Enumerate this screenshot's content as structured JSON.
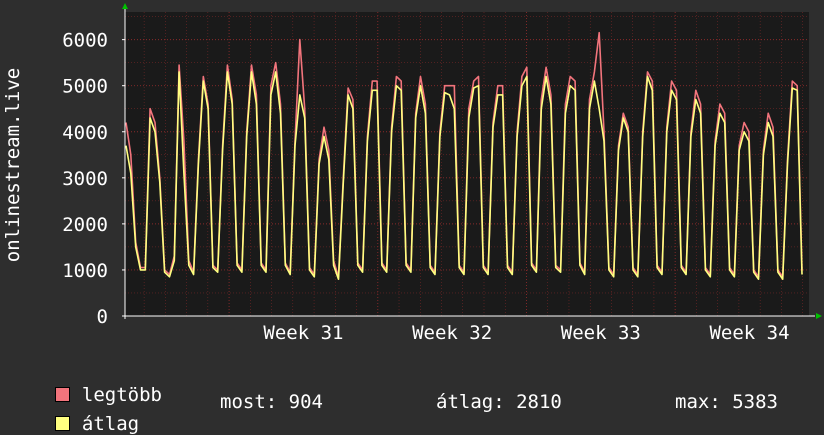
{
  "chart_data": {
    "type": "line",
    "ylabel": "onlinestream.live",
    "ylim": [
      0,
      6600
    ],
    "yticks": [
      0,
      1000,
      2000,
      3000,
      4000,
      5000,
      6000
    ],
    "xrange_weeks": [
      30.3,
      34.9
    ],
    "xticks": [
      {
        "label": "Week 31",
        "at": 31
      },
      {
        "label": "Week 32",
        "at": 32
      },
      {
        "label": "Week 33",
        "at": 33
      },
      {
        "label": "Week 34",
        "at": 34
      }
    ],
    "grid": true,
    "legend_placement": "bottom",
    "series": [
      {
        "name": "legtöbb",
        "color": "#f2747c",
        "values": [
          4200,
          3500,
          1600,
          1050,
          1050,
          4500,
          4200,
          3000,
          1000,
          900,
          1300,
          5450,
          3800,
          1200,
          950,
          3400,
          5200,
          4600,
          1100,
          1000,
          3700,
          5450,
          4700,
          1150,
          1000,
          4000,
          5450,
          4800,
          1150,
          1000,
          5000,
          5500,
          4600,
          1150,
          950,
          3800,
          6000,
          4500,
          1050,
          900,
          3400,
          4100,
          3600,
          1200,
          850,
          3000,
          4950,
          4700,
          1150,
          1000,
          3900,
          5100,
          5100,
          1150,
          1000,
          4100,
          5200,
          5100,
          1150,
          1000,
          4400,
          5200,
          4600,
          1100,
          950,
          4000,
          5000,
          5000,
          5000,
          1100,
          950,
          4500,
          5100,
          5200,
          1100,
          950,
          4200,
          5000,
          5000,
          1100,
          950,
          4000,
          5200,
          5400,
          1150,
          1000,
          4700,
          5400,
          4800,
          1100,
          1000,
          4600,
          5200,
          5100,
          1150,
          950,
          4700,
          5300,
          6150,
          4000,
          1050,
          900,
          3700,
          4400,
          4100,
          1050,
          900,
          4000,
          5300,
          5100,
          1100,
          950,
          4100,
          5100,
          4900,
          1100,
          950,
          4000,
          4900,
          4600,
          1050,
          900,
          3800,
          4600,
          4400,
          1050,
          900,
          3700,
          4200,
          4000,
          1000,
          850,
          3600,
          4400,
          4100,
          1000,
          850,
          3400,
          5100,
          5000,
          1000
        ]
      },
      {
        "name": "átlag",
        "color": "#ffff80",
        "values": [
          3700,
          3100,
          1500,
          1000,
          1000,
          4300,
          4000,
          2900,
          950,
          850,
          1200,
          5300,
          3100,
          1100,
          900,
          3300,
          5100,
          4500,
          1050,
          950,
          3600,
          5300,
          4600,
          1100,
          950,
          3900,
          5300,
          4600,
          1100,
          950,
          4800,
          5300,
          4400,
          1100,
          900,
          3700,
          4800,
          4300,
          1000,
          850,
          3300,
          3900,
          3400,
          1100,
          800,
          2900,
          4800,
          4500,
          1100,
          950,
          3800,
          4900,
          4900,
          1100,
          950,
          4000,
          5000,
          4900,
          1100,
          950,
          4300,
          5000,
          4400,
          1050,
          900,
          3900,
          4850,
          4800,
          4500,
          1050,
          900,
          4300,
          4950,
          5000,
          1050,
          900,
          4100,
          4800,
          4800,
          1050,
          900,
          3900,
          5000,
          5200,
          1100,
          950,
          4500,
          5200,
          4600,
          1050,
          950,
          4400,
          5000,
          4900,
          1100,
          900,
          4500,
          5100,
          4500,
          3800,
          1000,
          850,
          3600,
          4300,
          4000,
          1000,
          850,
          3900,
          5200,
          4900,
          1050,
          900,
          4000,
          4900,
          4700,
          1050,
          900,
          3900,
          4700,
          4400,
          1000,
          850,
          3700,
          4400,
          4200,
          1000,
          850,
          3600,
          4000,
          3800,
          950,
          800,
          3500,
          4200,
          3900,
          950,
          800,
          3300,
          4950,
          4900,
          900
        ]
      }
    ]
  },
  "legend": {
    "rows": [
      {
        "swatch_color": "#f2747c",
        "label": "legtöbb"
      },
      {
        "swatch_color": "#ffff80",
        "label": "átlag"
      }
    ]
  },
  "stats": {
    "current": "most: 904",
    "average": "átlag: 2810",
    "maximum": "max: 5383"
  },
  "colors": {
    "background": "#2e2e2e",
    "plot_background": "#1a1a1a",
    "grid": "#8a2a2a",
    "axis": "#ffffff",
    "arrow": "#00c000"
  }
}
